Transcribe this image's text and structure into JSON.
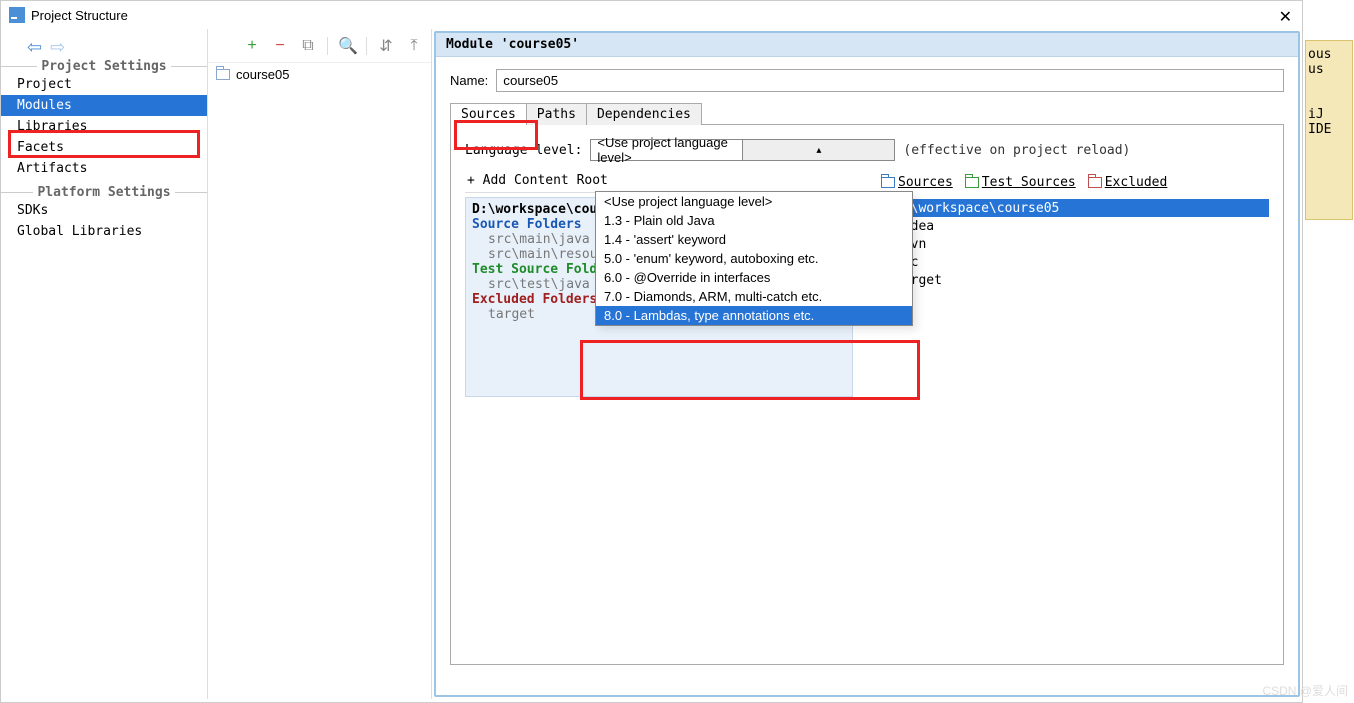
{
  "window": {
    "title": "Project Structure"
  },
  "sidebar": {
    "sections": {
      "project_settings": "Project Settings",
      "platform_settings": "Platform Settings"
    },
    "items": {
      "project": "Project",
      "modules": "Modules",
      "libraries": "Libraries",
      "facets": "Facets",
      "artifacts": "Artifacts",
      "sdks": "SDKs",
      "global_libraries": "Global Libraries"
    }
  },
  "middle": {
    "module_name": "course05"
  },
  "main": {
    "header": "Module 'course05'",
    "name_label": "Name:",
    "name_value": "course05",
    "tabs": {
      "sources": "Sources",
      "paths": "Paths",
      "dependencies": "Dependencies"
    },
    "lang_label": "Language level:",
    "lang_value": "<Use project language level>",
    "lang_hint": "(effective on project reload)",
    "add_content_root": "+ Add Content Root",
    "marks": {
      "sources": "Sources",
      "test_sources": "Test Sources",
      "excluded": "Excluded"
    },
    "root_path": "D:\\workspace\\course05",
    "folders": {
      "source_head": "Source Folders",
      "source_items": [
        "src\\main\\java",
        "src\\main\\resources"
      ],
      "test_head": "Test Source Folders",
      "test_items": [
        "src\\test\\java"
      ],
      "excluded_head": "Excluded Folders",
      "excluded_items": [
        "target"
      ]
    },
    "dropdown_options": [
      "<Use project language level>",
      "1.3 - Plain old Java",
      "1.4 - 'assert' keyword",
      "5.0 - 'enum' keyword, autoboxing etc.",
      "6.0 - @Override in interfaces",
      "7.0 - Diamonds, ARM, multi-catch etc.",
      "8.0 - Lambdas, type annotations etc."
    ],
    "tree": {
      "root": "D:\\workspace\\course05",
      "children": [
        ".idea",
        ".mvn",
        "src",
        "target"
      ]
    }
  },
  "behind": {
    "line1": "ous us",
    "line2": "iJ IDE"
  },
  "watermark": "CSDN @爱人间"
}
